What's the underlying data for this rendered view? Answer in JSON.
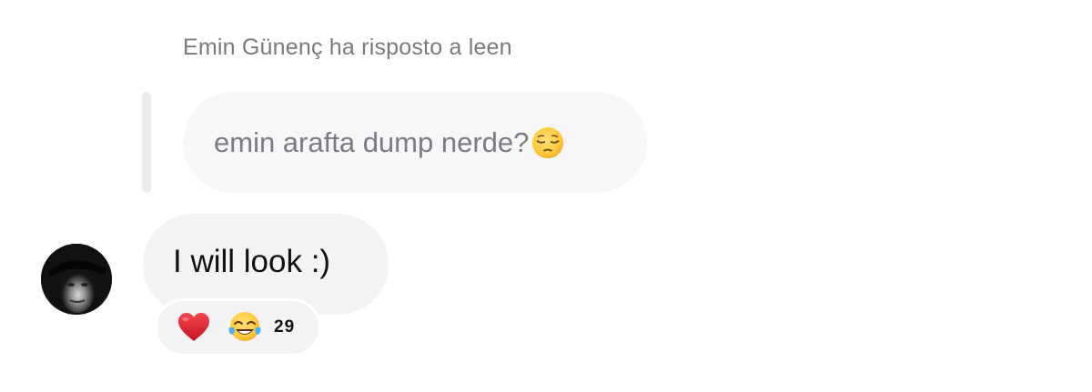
{
  "reply": {
    "header_text": "Emin Günenç ha risposto a leen",
    "quoted_message": {
      "text": "emin arafta dump nerde?",
      "emoji": "pensive-face"
    }
  },
  "message": {
    "text": "I will look :)",
    "sender_avatar": "avatar-photo"
  },
  "reactions": {
    "emojis": [
      "red-heart",
      "face-with-tears-of-joy"
    ],
    "count": "29"
  },
  "colors": {
    "background": "#ffffff",
    "bubble": "#f3f3f6",
    "quoted_bubble": "#f7f7f9",
    "muted_text": "#7a7a7e",
    "primary_text": "#111111",
    "heart": "#e0242f",
    "emoji_yellow": "#ffc93a"
  }
}
